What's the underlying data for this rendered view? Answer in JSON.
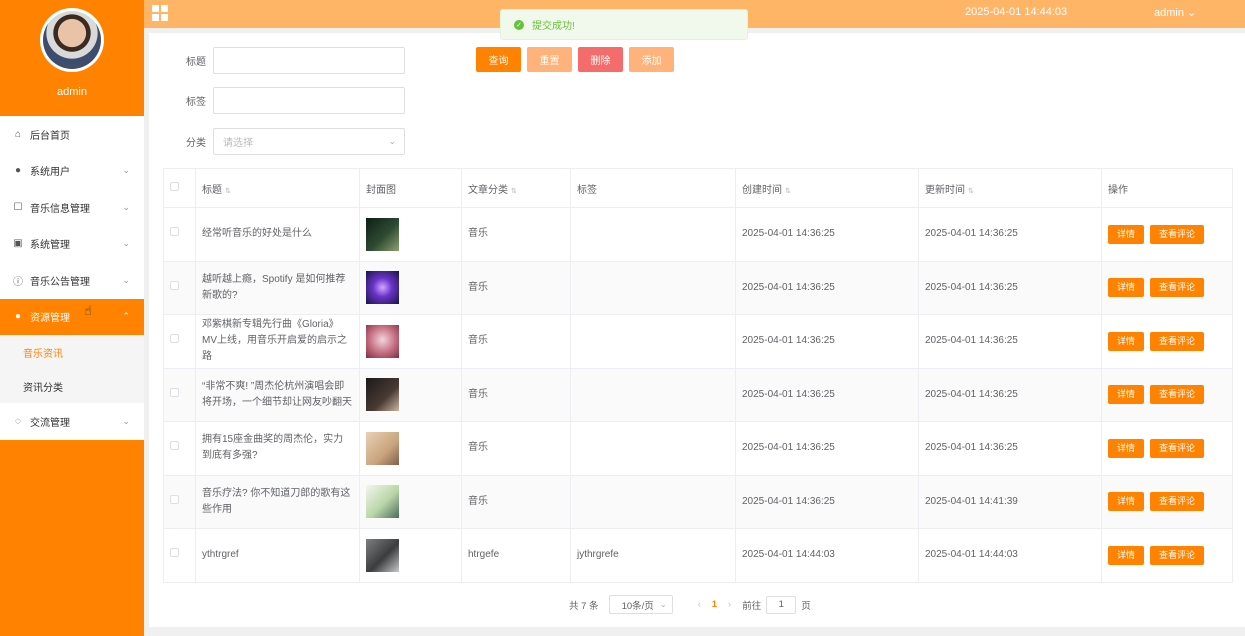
{
  "app": {
    "user": "admin",
    "datetime": "2025-04-01 14:44:03",
    "header_user": "admin ⌄"
  },
  "toast": {
    "text": "提交成功!"
  },
  "colors": {
    "accent": "#ff8200",
    "header": "#ffb566",
    "danger": "#f56c6c",
    "success": "#67c23a"
  },
  "sidebar": {
    "items": [
      {
        "label": "后台首页",
        "icon": "home-icon",
        "glyph": "⌂",
        "expandable": false
      },
      {
        "label": "系统用户",
        "icon": "user-icon",
        "glyph": "●",
        "expandable": true
      },
      {
        "label": "音乐信息管理",
        "icon": "document-icon",
        "glyph": "☐",
        "expandable": true
      },
      {
        "label": "系统管理",
        "icon": "image-icon",
        "glyph": "▣",
        "expandable": true
      },
      {
        "label": "音乐公告管理",
        "icon": "info-icon",
        "glyph": "ⓘ",
        "expandable": true
      },
      {
        "label": "资源管理",
        "icon": "bulb-icon",
        "glyph": "●",
        "expandable": true,
        "active": true
      }
    ],
    "sub_items": [
      {
        "label": "音乐资讯",
        "active": true
      },
      {
        "label": "资讯分类",
        "active": false
      }
    ],
    "last_item": {
      "label": "交流管理",
      "icon": "chat-icon",
      "glyph": "◌"
    }
  },
  "search": {
    "title_label": "标题",
    "tag_label": "标签",
    "category_label": "分类",
    "category_placeholder": "请选择",
    "buttons": {
      "query": "查询",
      "reset": "重置",
      "delete": "删除",
      "add": "添加"
    }
  },
  "table": {
    "headers": {
      "title": "标题",
      "cover": "封面图",
      "category": "文章分类",
      "tag": "标签",
      "created": "创建时间",
      "updated": "更新时间",
      "actions": "操作"
    },
    "action_labels": {
      "detail": "详情",
      "comments": "查看评论"
    },
    "rows": [
      {
        "title": "经常听音乐的好处是什么",
        "category": "音乐",
        "tag": "",
        "created": "2025-04-01 14:36:25",
        "updated": "2025-04-01 14:36:25"
      },
      {
        "title": "越听越上瘾，Spotify 是如何推荐新歌的?",
        "category": "音乐",
        "tag": "",
        "created": "2025-04-01 14:36:25",
        "updated": "2025-04-01 14:36:25"
      },
      {
        "title": "邓紫棋新专辑先行曲《Gloria》MV上线，用音乐开启爱的启示之路",
        "category": "音乐",
        "tag": "",
        "created": "2025-04-01 14:36:25",
        "updated": "2025-04-01 14:36:25"
      },
      {
        "title": "“非常不爽! ”周杰伦杭州演唱会即将开场，一个细节却让网友吵翻天",
        "category": "音乐",
        "tag": "",
        "created": "2025-04-01 14:36:25",
        "updated": "2025-04-01 14:36:25"
      },
      {
        "title": "拥有15座金曲奖的周杰伦，实力到底有多强?",
        "category": "音乐",
        "tag": "",
        "created": "2025-04-01 14:36:25",
        "updated": "2025-04-01 14:36:25"
      },
      {
        "title": "音乐疗法? 你不知道刀郎的歌有这些作用",
        "category": "音乐",
        "tag": "",
        "created": "2025-04-01 14:36:25",
        "updated": "2025-04-01 14:41:39"
      },
      {
        "title": "ythtrgref",
        "category": "htrgefe",
        "tag": "jythrgrefe",
        "created": "2025-04-01 14:44:03",
        "updated": "2025-04-01 14:44:03"
      }
    ]
  },
  "pagination": {
    "total": "共 7 条",
    "page_size": "10条/页",
    "current": "1",
    "goto_label": "前往",
    "goto_value": "1",
    "page_suffix": "页"
  }
}
